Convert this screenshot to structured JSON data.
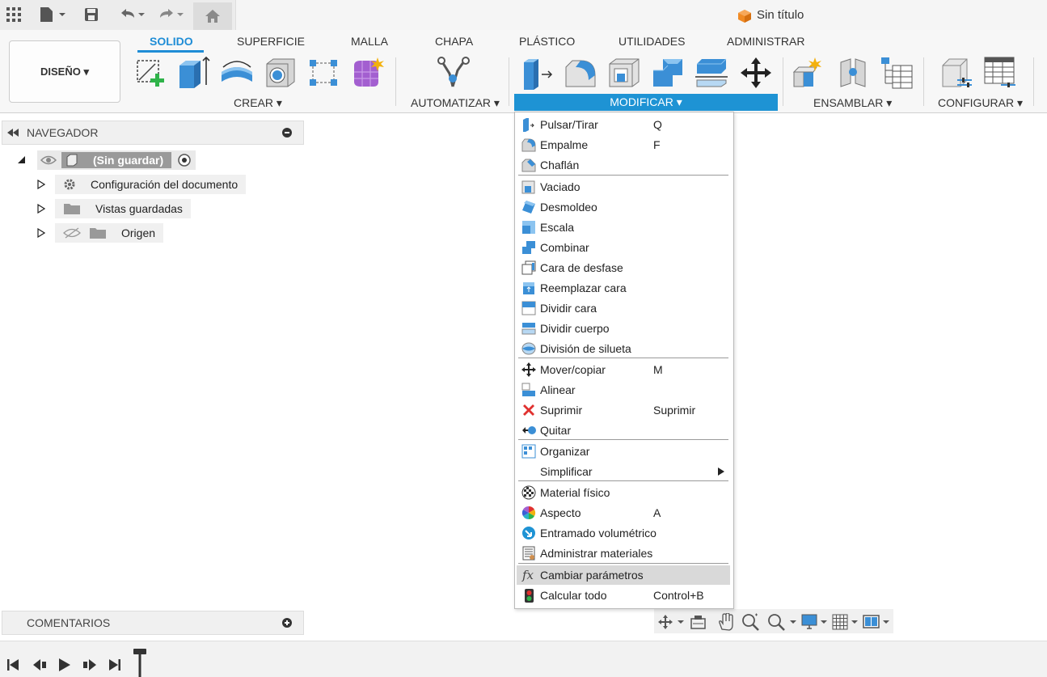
{
  "app": {
    "document_title": "Sin título"
  },
  "ribbon": {
    "workspace_button": "DISEÑO ▾",
    "tabs": [
      "SOLIDO",
      "SUPERFICIE",
      "MALLA",
      "CHAPA",
      "PLÁSTICO",
      "UTILIDADES",
      "ADMINISTRAR"
    ],
    "groups": {
      "crear": "CREAR ▾",
      "automatizar": "AUTOMATIZAR ▾",
      "modificar": "MODIFICAR ▾",
      "ensamblar": "ENSAMBLAR ▾",
      "configurar": "CONFIGURAR ▾"
    }
  },
  "navigator": {
    "title": "NAVEGADOR",
    "root_label": "(Sin guardar)",
    "items": [
      "Configuración del documento",
      "Vistas guardadas",
      "Origen"
    ]
  },
  "comments": {
    "title": "COMENTARIOS"
  },
  "menu": {
    "items": [
      {
        "label": "Pulsar/Tirar",
        "shortcut": "Q",
        "icon": "press-pull-icon"
      },
      {
        "label": "Empalme",
        "shortcut": "F",
        "icon": "fillet-icon"
      },
      {
        "label": "Chaflán",
        "shortcut": "",
        "icon": "chamfer-icon"
      },
      {
        "label": "Vaciado",
        "shortcut": "",
        "icon": "shell-icon"
      },
      {
        "label": "Desmoldeo",
        "shortcut": "",
        "icon": "draft-icon"
      },
      {
        "label": "Escala",
        "shortcut": "",
        "icon": "scale-icon"
      },
      {
        "label": "Combinar",
        "shortcut": "",
        "icon": "combine-icon"
      },
      {
        "label": "Cara de desfase",
        "shortcut": "",
        "icon": "offset-face-icon"
      },
      {
        "label": "Reemplazar cara",
        "shortcut": "",
        "icon": "replace-face-icon"
      },
      {
        "label": "Dividir cara",
        "shortcut": "",
        "icon": "split-face-icon"
      },
      {
        "label": "Dividir cuerpo",
        "shortcut": "",
        "icon": "split-body-icon"
      },
      {
        "label": "División de silueta",
        "shortcut": "",
        "icon": "silhouette-split-icon"
      },
      {
        "label": "Mover/copiar",
        "shortcut": "M",
        "icon": "move-icon"
      },
      {
        "label": "Alinear",
        "shortcut": "",
        "icon": "align-icon"
      },
      {
        "label": "Suprimir",
        "shortcut": "Suprimir",
        "icon": "delete-icon"
      },
      {
        "label": "Quitar",
        "shortcut": "",
        "icon": "remove-icon"
      },
      {
        "label": "Organizar",
        "shortcut": "",
        "icon": "arrange-icon"
      },
      {
        "label": "Simplificar",
        "shortcut": "",
        "icon": "simplify-icon"
      },
      {
        "label": "Material físico",
        "shortcut": "",
        "icon": "physical-material-icon"
      },
      {
        "label": "Aspecto",
        "shortcut": "A",
        "icon": "appearance-icon"
      },
      {
        "label": "Entramado volumétrico",
        "shortcut": "",
        "icon": "volumetric-lattice-icon"
      },
      {
        "label": "Administrar materiales",
        "shortcut": "",
        "icon": "manage-materials-icon"
      },
      {
        "label": "Cambiar parámetros",
        "shortcut": "",
        "icon": "fx-icon"
      },
      {
        "label": "Calcular todo",
        "shortcut": "Control+B",
        "icon": "compute-all-icon"
      }
    ],
    "highlighted_index": 22
  },
  "colors": {
    "accent": "#1e93d4",
    "highlight": "#d9d9d9"
  }
}
